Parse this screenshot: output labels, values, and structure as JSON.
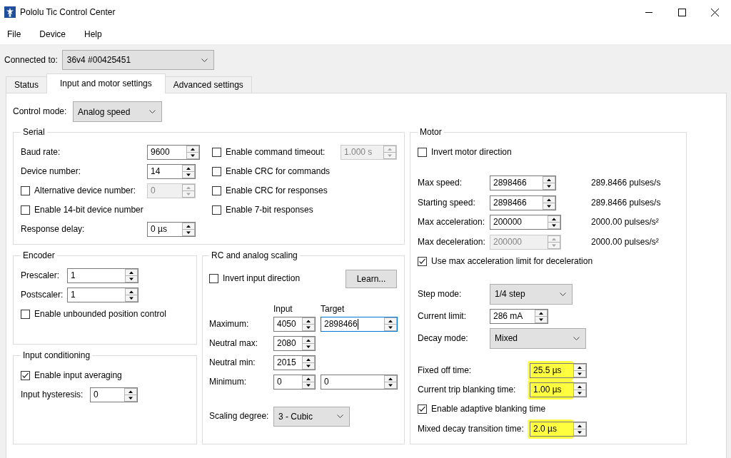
{
  "window": {
    "title": "Pololu Tic Control Center"
  },
  "menu": [
    {
      "label": "File"
    },
    {
      "label": "Device"
    },
    {
      "label": "Help"
    }
  ],
  "connection": {
    "label": "Connected to:",
    "device": "36v4 #00425451"
  },
  "tabs": [
    {
      "label": "Status",
      "selected": false
    },
    {
      "label": "Input and motor settings",
      "selected": true
    },
    {
      "label": "Advanced settings",
      "selected": false
    }
  ],
  "control_mode": {
    "label": "Control mode:",
    "value": "Analog speed"
  },
  "serial": {
    "title": "Serial",
    "left_rows": [
      {
        "kind": "spin",
        "label": "Baud rate:",
        "value": "9600",
        "disabled": false
      },
      {
        "kind": "spin",
        "label": "Device number:",
        "value": "14",
        "disabled": false
      },
      {
        "kind": "check_spin",
        "label": "Alternative device number:",
        "checked": false,
        "value": "0",
        "disabled": true
      },
      {
        "kind": "check",
        "label": "Enable 14-bit device number",
        "checked": false
      },
      {
        "kind": "spin",
        "label": "Response delay:",
        "value": "0 µs",
        "disabled": false
      }
    ],
    "right_rows": [
      {
        "kind": "check_spin",
        "label": "Enable command timeout:",
        "checked": false,
        "value": "1.000 s",
        "disabled": true
      },
      {
        "kind": "check",
        "label": "Enable CRC for commands",
        "checked": false
      },
      {
        "kind": "check",
        "label": "Enable CRC for responses",
        "checked": false
      },
      {
        "kind": "check",
        "label": "Enable 7-bit responses",
        "checked": false
      }
    ]
  },
  "encoder": {
    "title": "Encoder",
    "rows": [
      {
        "kind": "spin",
        "label": "Prescaler:",
        "value": "1",
        "disabled": false
      },
      {
        "kind": "spin",
        "label": "Postscaler:",
        "value": "1",
        "disabled": false
      },
      {
        "kind": "check",
        "label": "Enable unbounded position control",
        "checked": false
      }
    ]
  },
  "input_conditioning": {
    "title": "Input conditioning",
    "rows": [
      {
        "kind": "check",
        "label": "Enable input averaging",
        "checked": true
      },
      {
        "kind": "spin",
        "label": "Input hysteresis:",
        "value": "0",
        "disabled": false
      }
    ]
  },
  "rc_scaling": {
    "title": "RC and analog scaling",
    "invert": {
      "label": "Invert input direction",
      "checked": false
    },
    "learn_button": "Learn...",
    "column_headers": [
      "Input",
      "Target"
    ],
    "rows": [
      {
        "label": "Maximum:",
        "input": "4050",
        "target": "2898466",
        "target_focused": true
      },
      {
        "label": "Neutral max:",
        "input": "2080"
      },
      {
        "label": "Neutral min:",
        "input": "2015"
      },
      {
        "label": "Minimum:",
        "input": "0",
        "target": "0",
        "target_focused": false
      }
    ],
    "scaling_degree": {
      "label": "Scaling degree:",
      "value": "3 - Cubic"
    }
  },
  "motor": {
    "title": "Motor",
    "sections": [
      [
        {
          "kind": "check",
          "label": "Invert motor direction",
          "checked": false
        }
      ],
      [
        {
          "kind": "spin",
          "label": "Max speed:",
          "value": "2898466",
          "disabled": false,
          "highlighted": false,
          "reading": "289.8466 pulses/s"
        },
        {
          "kind": "spin",
          "label": "Starting speed:",
          "value": "2898466",
          "disabled": false,
          "highlighted": false,
          "reading": "289.8466 pulses/s"
        },
        {
          "kind": "spin",
          "label": "Max acceleration:",
          "value": "200000",
          "disabled": false,
          "highlighted": false,
          "reading": "2000.00 pulses/s²"
        },
        {
          "kind": "spin",
          "label": "Max deceleration:",
          "value": "200000",
          "disabled": true,
          "highlighted": false,
          "reading": "2000.00 pulses/s²"
        },
        {
          "kind": "check",
          "label": "Use max acceleration limit for deceleration",
          "checked": true
        }
      ],
      [
        {
          "kind": "combo",
          "label": "Step mode:",
          "value": "1/4 step"
        },
        {
          "kind": "spin",
          "label": "Current limit:",
          "value": "286 mA",
          "disabled": false,
          "highlighted": false
        },
        {
          "kind": "combo",
          "label": "Decay mode:",
          "value": "Mixed"
        }
      ],
      [
        {
          "kind": "spin",
          "label": "Fixed off time:",
          "value": "25.5 µs",
          "disabled": false,
          "highlighted": true
        },
        {
          "kind": "spin",
          "label": "Current trip blanking time:",
          "value": "1.00 µs",
          "disabled": false,
          "highlighted": true
        },
        {
          "kind": "check",
          "label": "Enable adaptive blanking time",
          "checked": true
        },
        {
          "kind": "spin",
          "label": "Mixed decay transition time:",
          "value": "2.0 µs",
          "disabled": false,
          "highlighted": true
        }
      ]
    ]
  }
}
